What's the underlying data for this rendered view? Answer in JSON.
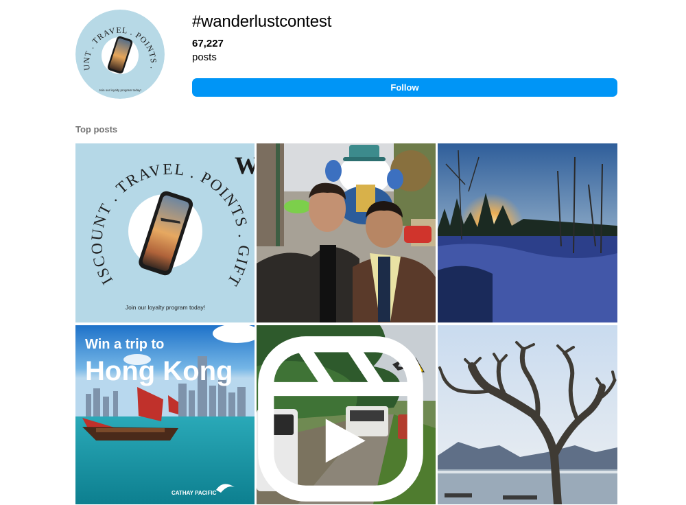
{
  "hashtag": {
    "title": "#wanderlustcontest",
    "post_count": "67,227",
    "post_count_label": "posts",
    "follow_label": "Follow"
  },
  "avatar": {
    "ring_text": "DISCOUNT . TRAVEL . POINTS . GIFTS",
    "footer_text": "Join our loyalty program today!"
  },
  "section": {
    "top_posts_label": "Top posts"
  },
  "posts": [
    {
      "kind": "loyalty-graphic",
      "ring_text": "DISCOUNT . TRAVEL . POINTS . GIFTS",
      "footer_text": "Join our loyalty program today!",
      "logo_letter": "W"
    },
    {
      "kind": "photo-parade"
    },
    {
      "kind": "photo-snow-sunset"
    },
    {
      "kind": "hong-kong-ad",
      "line1": "Win a trip to",
      "line2": "Hong Kong",
      "brand": "CATHAY PACIFIC"
    },
    {
      "kind": "photo-road",
      "reel": true
    },
    {
      "kind": "photo-tree-lake"
    }
  ],
  "colors": {
    "accent": "#0095f6",
    "muted": "#737373",
    "avatar_bg": "#b7d9e6"
  }
}
